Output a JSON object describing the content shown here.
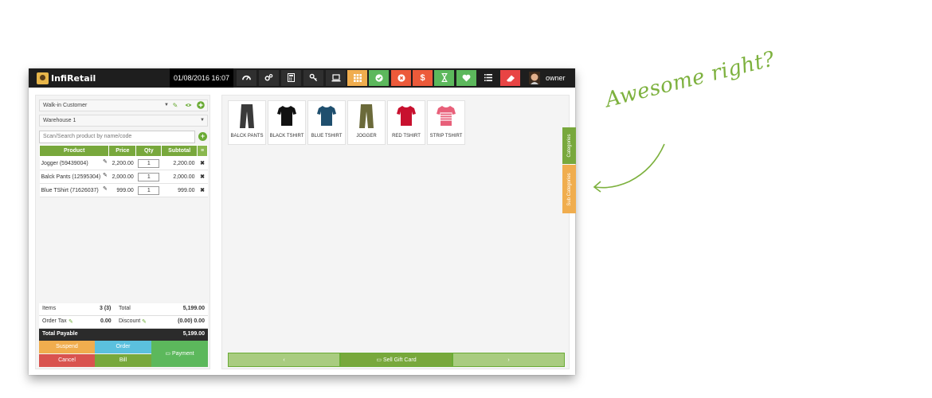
{
  "topbar": {
    "logo_text": "InfiRetail",
    "datetime": "01/08/2016 16:07",
    "user_name": "owner",
    "buttons": [
      {
        "icon": "dashboard-icon",
        "color": "#2f2f2f"
      },
      {
        "icon": "settings-icon",
        "color": "#2f2f2f"
      },
      {
        "icon": "calculator-icon",
        "color": "#2f2f2f"
      },
      {
        "icon": "key-icon",
        "color": "#2f2f2f"
      },
      {
        "icon": "laptop-icon",
        "color": "#2f2f2f"
      },
      {
        "icon": "grid-icon",
        "color": "#f0ad4e"
      },
      {
        "icon": "check-circle-icon",
        "color": "#5cb85c"
      },
      {
        "icon": "close-circle-icon",
        "color": "#ec5a3a"
      },
      {
        "icon": "dollar-icon",
        "color": "#ec5a3a"
      },
      {
        "icon": "hourglass-icon",
        "color": "#5cb85c"
      },
      {
        "icon": "heart-icon",
        "color": "#5cb85c"
      },
      {
        "icon": "list-icon",
        "color": "transparent"
      },
      {
        "icon": "eraser-icon",
        "color": "#e84444"
      }
    ]
  },
  "customer": {
    "value": "Walk-in Customer"
  },
  "warehouse": {
    "value": "Warehouse 1"
  },
  "search": {
    "placeholder": "Scan/Search product by name/code"
  },
  "cart": {
    "headers": {
      "product": "Product",
      "price": "Price",
      "qty": "Qty",
      "subtotal": "Subtotal"
    },
    "rows": [
      {
        "product": "Jogger (59439004)",
        "price": "2,200.00",
        "qty": "1",
        "subtotal": "2,200.00"
      },
      {
        "product": "Balck Pants (12595304)",
        "price": "2,000.00",
        "qty": "1",
        "subtotal": "2,000.00"
      },
      {
        "product": "Blue TShirt (71626037)",
        "price": "999.00",
        "qty": "1",
        "subtotal": "999.00"
      }
    ]
  },
  "totals": {
    "items_label": "Items",
    "items_value": "3 (3)",
    "total_label": "Total",
    "total_value": "5,199.00",
    "tax_label": "Order Tax",
    "tax_value": "0.00",
    "discount_label": "Discount",
    "discount_value": "(0.00) 0.00",
    "payable_label": "Total Payable",
    "payable_value": "5,199.00"
  },
  "actions": {
    "suspend": "Suspend",
    "order": "Order",
    "payment": "Payment",
    "cancel": "Cancel",
    "bill": "Bill"
  },
  "products": [
    {
      "name": "BALCK PANTS",
      "color": "#3a3a3a",
      "kind": "pants"
    },
    {
      "name": "BLACK TSHIRT",
      "color": "#111111",
      "kind": "shirt"
    },
    {
      "name": "BLUE TSHIRT",
      "color": "#1f4f6e",
      "kind": "shirt"
    },
    {
      "name": "JOGGER",
      "color": "#6b6a3a",
      "kind": "pants"
    },
    {
      "name": "RED TSHIRT",
      "color": "#c8102e",
      "kind": "shirt"
    },
    {
      "name": "STRIP TSHIRT",
      "color": "#e8607a",
      "kind": "shirt"
    }
  ],
  "bottombar": {
    "prev": "‹",
    "gift": "Sell Gift Card",
    "next": "›"
  },
  "sidetabs": {
    "categories": "Categories",
    "subcategories": "Sub Categories"
  },
  "annotation": {
    "text": "Awesome right?"
  },
  "colors": {
    "accent_green": "#78a83c",
    "orange": "#f0ad4e",
    "blue": "#5bc0de",
    "red": "#d9534f",
    "payment_green": "#5cb85c"
  }
}
